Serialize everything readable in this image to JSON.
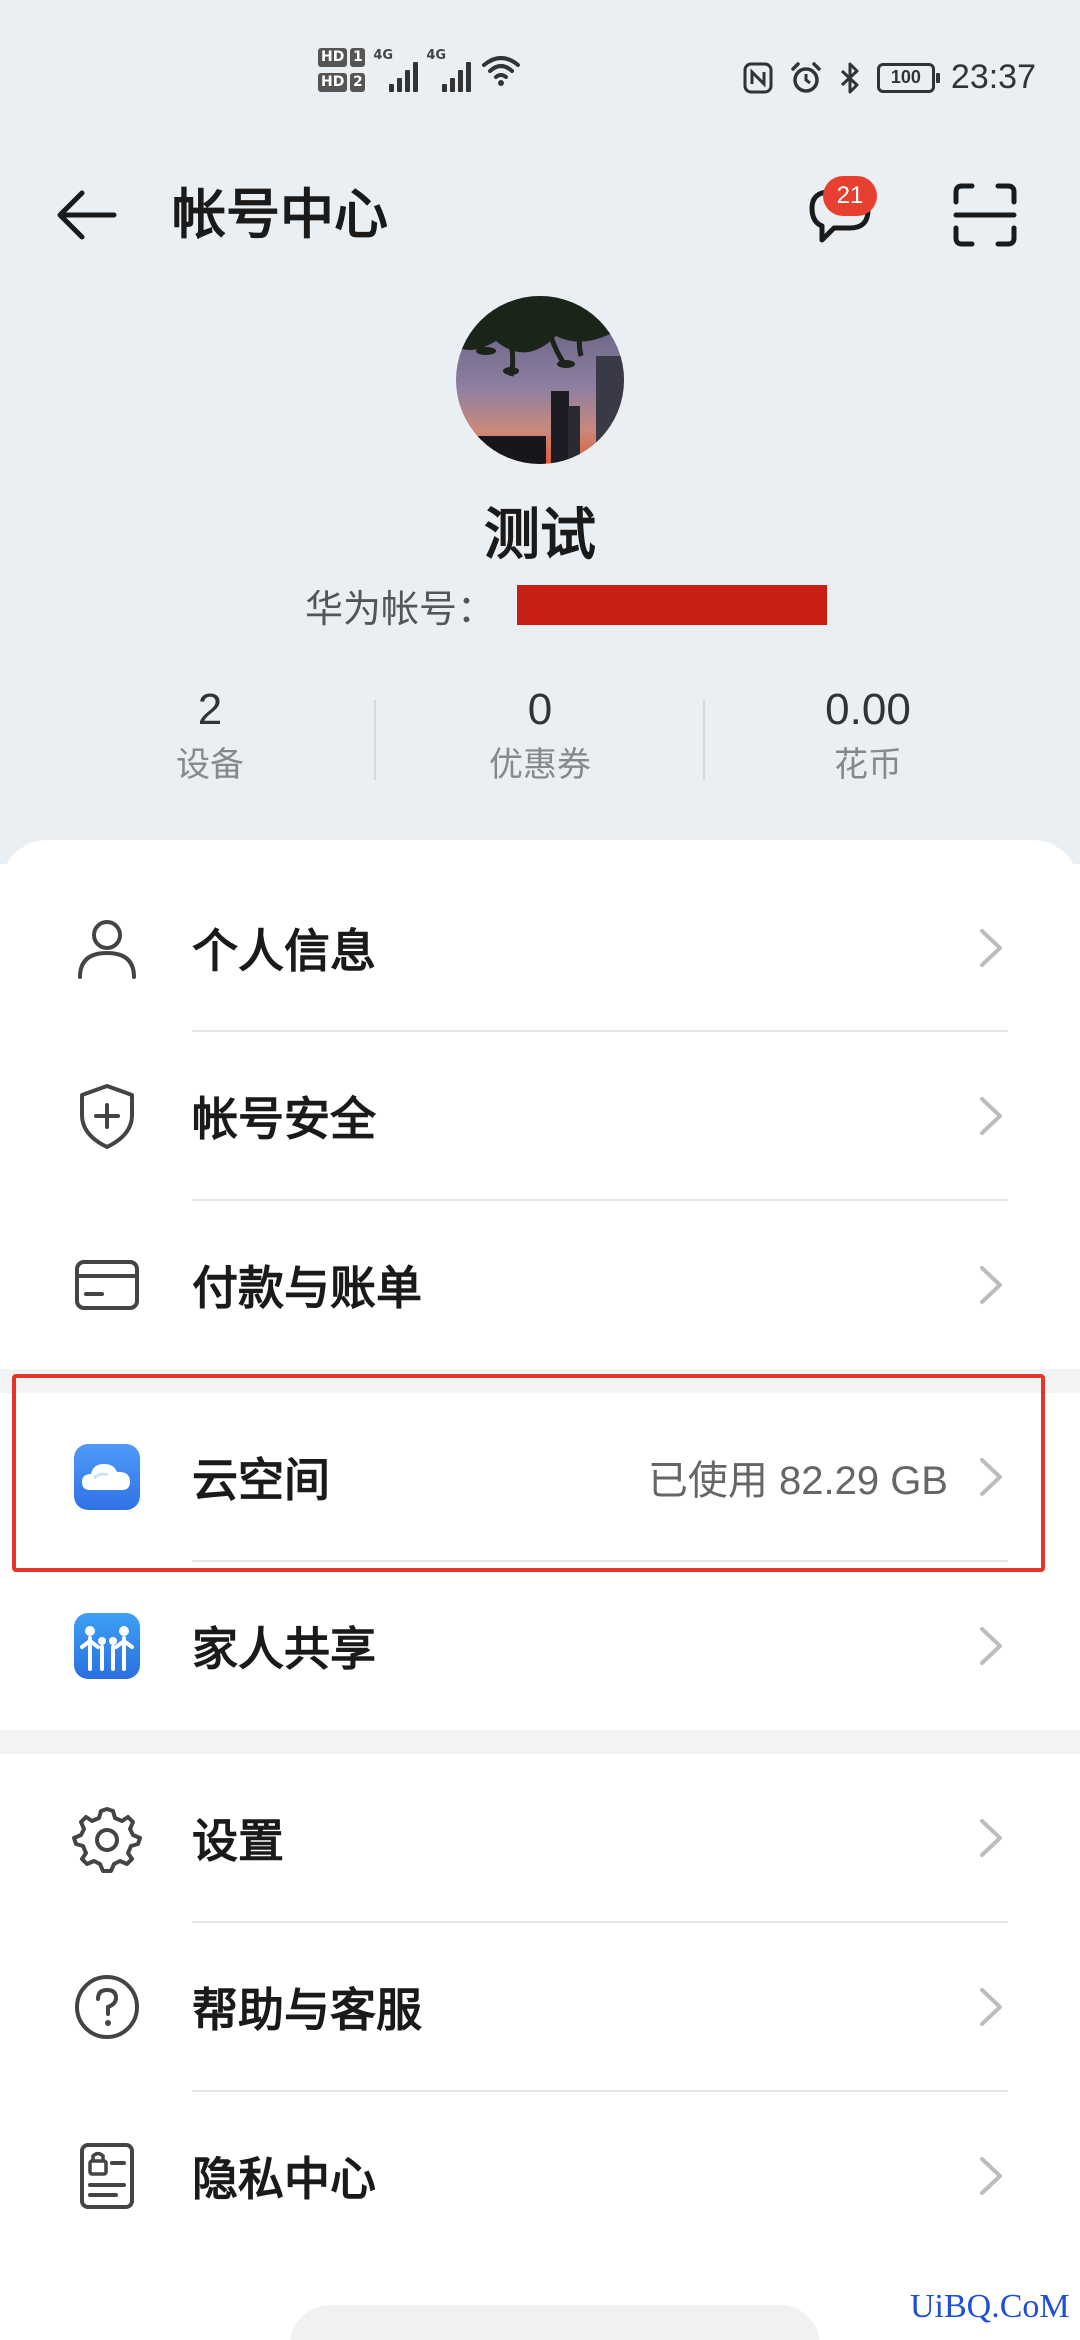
{
  "status_bar": {
    "sim1_label": "HD",
    "sim1_num": "1",
    "sim2_label": "HD",
    "sim2_num": "2",
    "network1": "4G",
    "network2": "4G",
    "battery": "100",
    "time": "23:37",
    "icons": [
      "nfc-icon",
      "alarm-icon",
      "bluetooth-icon"
    ]
  },
  "header": {
    "title": "帐号中心",
    "message_badge": "21"
  },
  "profile": {
    "name": "测试",
    "account_label": "华为帐号："
  },
  "stats": [
    {
      "value": "2",
      "label": "设备"
    },
    {
      "value": "0",
      "label": "优惠券"
    },
    {
      "value": "0.00",
      "label": "花币"
    }
  ],
  "menu": {
    "group1": [
      {
        "label": "个人信息",
        "icon": "person-icon"
      },
      {
        "label": "帐号安全",
        "icon": "shield-icon"
      },
      {
        "label": "付款与账单",
        "icon": "card-icon"
      }
    ],
    "group2": [
      {
        "label": "云空间",
        "icon": "cloud-icon",
        "value": "已使用 82.29 GB"
      },
      {
        "label": "家人共享",
        "icon": "family-icon"
      }
    ],
    "group3": [
      {
        "label": "设置",
        "icon": "gear-icon"
      },
      {
        "label": "帮助与客服",
        "icon": "help-icon"
      },
      {
        "label": "隐私中心",
        "icon": "privacy-icon"
      }
    ]
  },
  "colors": {
    "background": "#eaeff3",
    "badge": "#e84030",
    "highlight": "#e53527",
    "redaction": "#c81f14"
  },
  "watermark": "UiBQ.CoM"
}
